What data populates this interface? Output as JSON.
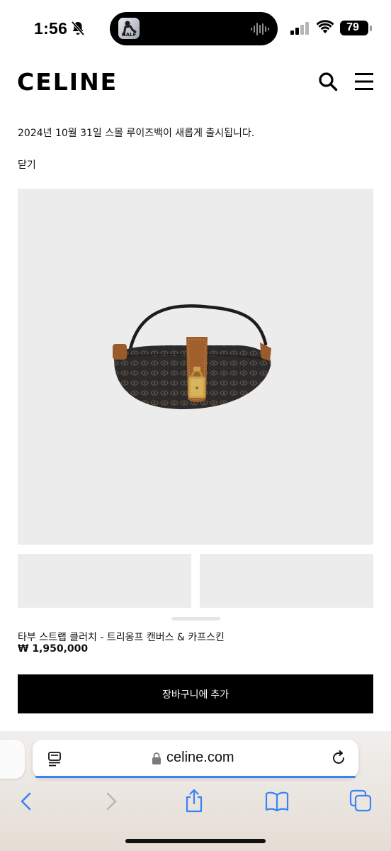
{
  "status_bar": {
    "time": "1:56",
    "battery": "79",
    "island_thumb_label": "HALF",
    "icons": [
      "bell-off-icon",
      "waveform-icon",
      "cell-signal-icon",
      "wifi-icon",
      "battery-icon"
    ]
  },
  "header": {
    "logo": "CELINE",
    "icons": [
      "search-icon",
      "menu-icon"
    ]
  },
  "announcement": {
    "text": "2024년 10월 31일 스몰 루이즈백이 새롭게 출시됩니다.",
    "close_label": "닫기"
  },
  "product": {
    "name": "타부 스트랩 클러치 - 트리옹프 캔버스 & 카프스킨",
    "price": "₩ 1,950,000",
    "add_to_cart_label": "장바구니에 추가"
  },
  "browser": {
    "url": "celine.com",
    "icons": [
      "reader-icon",
      "lock-icon",
      "reload-icon",
      "back-icon",
      "forward-icon",
      "share-icon",
      "bookmarks-icon",
      "tabs-icon"
    ]
  },
  "colors": {
    "image_background": "#ececec",
    "button": "#000000",
    "accent_blue": "#3a82f7",
    "leather_tan": "#a0602d",
    "hardware_gold": "#c9a24a"
  }
}
